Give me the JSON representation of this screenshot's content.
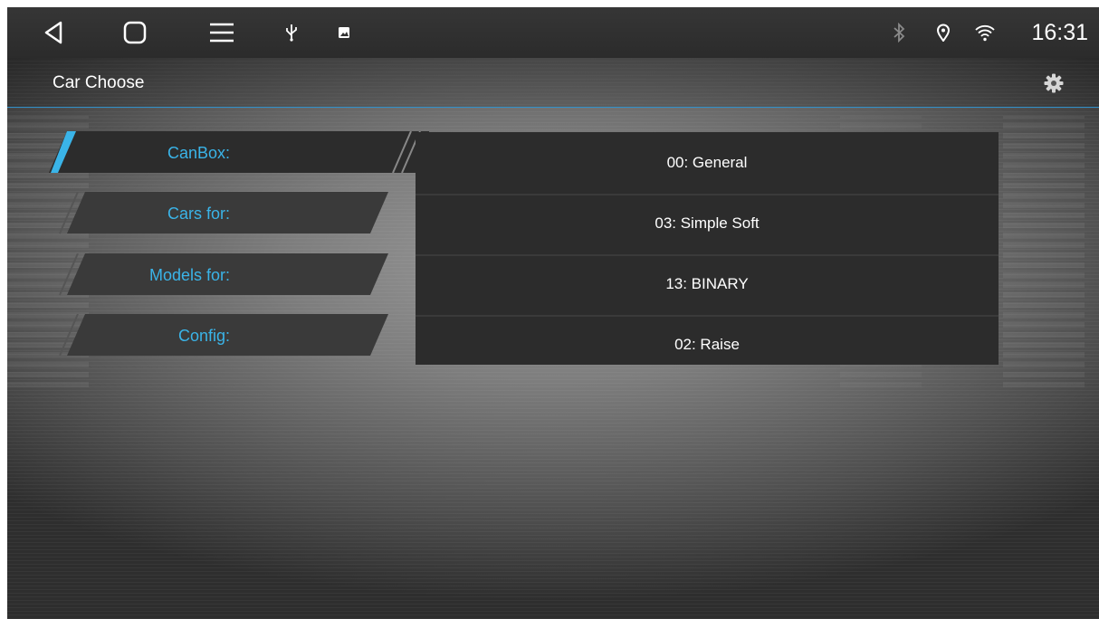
{
  "statusbar": {
    "time": "16:31",
    "left_icons": [
      "back-icon",
      "home-icon",
      "menu-icon",
      "usb-icon",
      "image-icon"
    ],
    "right_icons": [
      "bluetooth-icon",
      "location-icon",
      "wifi-icon"
    ]
  },
  "header": {
    "title": "Car Choose",
    "settings_icon": "gear-icon"
  },
  "menu": {
    "items": [
      {
        "label": "CanBox:",
        "selected": true
      },
      {
        "label": "Cars for:",
        "selected": false
      },
      {
        "label": "Models for:",
        "selected": false
      },
      {
        "label": "Config:",
        "selected": false
      }
    ]
  },
  "panel": {
    "values": [
      "00: General",
      "03: Simple Soft",
      "13: BINARY",
      "02: Raise"
    ]
  },
  "colors": {
    "accent": "#3ab4e8",
    "statusbar_bg": "#2e2e2e",
    "panel_bg": "#2c2c2c"
  }
}
